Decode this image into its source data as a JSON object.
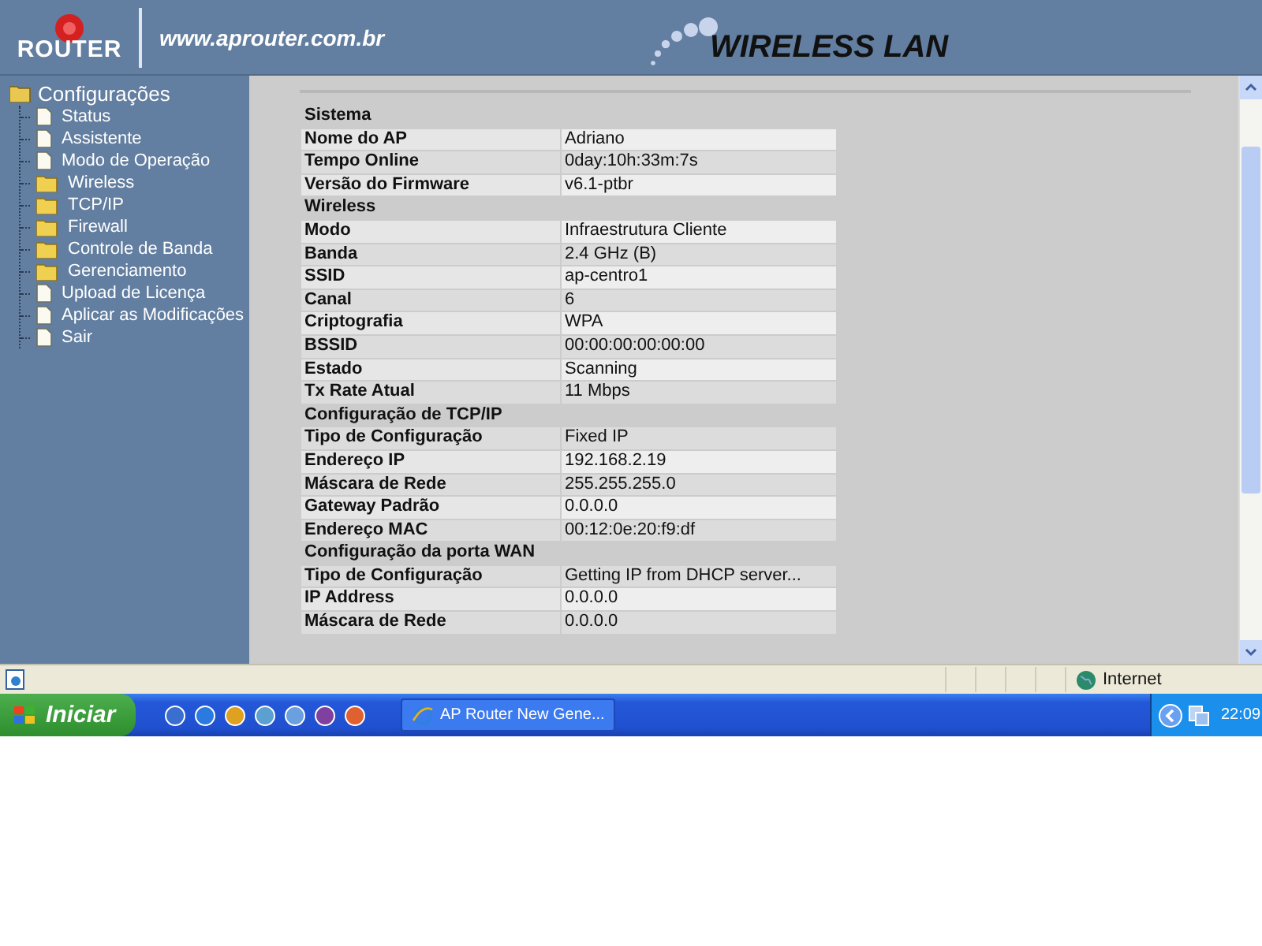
{
  "header": {
    "logo_text": "ROUTER",
    "site": "www.aprouter.com.br",
    "banner": "WIRELESS LAN"
  },
  "sidebar": {
    "root": "Configurações",
    "items": [
      {
        "label": "Status",
        "kind": "page"
      },
      {
        "label": "Assistente",
        "kind": "page"
      },
      {
        "label": "Modo de Operação",
        "kind": "page"
      },
      {
        "label": "Wireless",
        "kind": "folder"
      },
      {
        "label": "TCP/IP",
        "kind": "folder"
      },
      {
        "label": "Firewall",
        "kind": "folder"
      },
      {
        "label": "Controle de Banda",
        "kind": "folder"
      },
      {
        "label": "Gerenciamento",
        "kind": "folder"
      },
      {
        "label": "Upload de Licença",
        "kind": "page"
      },
      {
        "label": "Aplicar as Modificações",
        "kind": "page"
      },
      {
        "label": "Sair",
        "kind": "page"
      }
    ]
  },
  "sections": [
    {
      "title": "Sistema",
      "rows": [
        {
          "label": "Nome do AP",
          "value": "Adriano"
        },
        {
          "label": "Tempo Online",
          "value": "0day:10h:33m:7s"
        },
        {
          "label": "Versão do Firmware",
          "value": "v6.1-ptbr"
        }
      ]
    },
    {
      "title": "Wireless",
      "rows": [
        {
          "label": "Modo",
          "value": "Infraestrutura Cliente"
        },
        {
          "label": "Banda",
          "value": "2.4 GHz (B)"
        },
        {
          "label": "SSID",
          "value": "ap-centro1"
        },
        {
          "label": "Canal",
          "value": "6"
        },
        {
          "label": "Criptografia",
          "value": "WPA"
        },
        {
          "label": "BSSID",
          "value": "00:00:00:00:00:00"
        },
        {
          "label": "Estado",
          "value": "Scanning"
        },
        {
          "label": "Tx Rate Atual",
          "value": "11 Mbps"
        }
      ]
    },
    {
      "title": "Configuração de TCP/IP",
      "rows": [
        {
          "label": "Tipo de Configuração",
          "value": "Fixed IP"
        },
        {
          "label": "Endereço IP",
          "value": "192.168.2.19"
        },
        {
          "label": "Máscara de Rede",
          "value": "255.255.255.0"
        },
        {
          "label": "Gateway Padrão",
          "value": "0.0.0.0"
        },
        {
          "label": "Endereço MAC",
          "value": "00:12:0e:20:f9:df"
        }
      ]
    },
    {
      "title": "Configuração da porta WAN",
      "rows": [
        {
          "label": "Tipo de Configuração",
          "value": "Getting IP from DHCP server..."
        },
        {
          "label": "IP Address",
          "value": "0.0.0.0"
        },
        {
          "label": "Máscara de Rede",
          "value": "0.0.0.0"
        }
      ]
    }
  ],
  "status_bar": {
    "zone": "Internet"
  },
  "taskbar": {
    "start": "Iniciar",
    "window": "AP Router New Gene...",
    "clock": "22:09"
  }
}
